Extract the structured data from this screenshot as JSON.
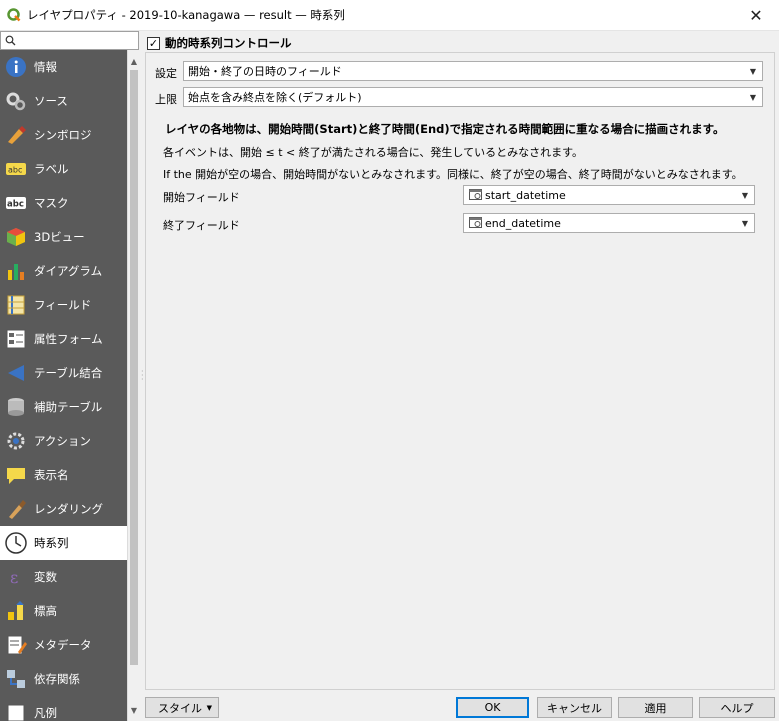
{
  "window": {
    "title": "レイヤプロパティ - 2019-10-kanagawa — result — 時系列",
    "close_glyph": "✕"
  },
  "search": {
    "placeholder": ""
  },
  "sidebar": {
    "items": [
      {
        "label": "情報",
        "icon": "info-icon"
      },
      {
        "label": "ソース",
        "icon": "source-icon"
      },
      {
        "label": "シンボロジ",
        "icon": "symbology-icon"
      },
      {
        "label": "ラベル",
        "icon": "labels-icon"
      },
      {
        "label": "マスク",
        "icon": "mask-icon"
      },
      {
        "label": "3Dビュー",
        "icon": "3d-view-icon"
      },
      {
        "label": "ダイアグラム",
        "icon": "diagram-icon"
      },
      {
        "label": "フィールド",
        "icon": "fields-icon"
      },
      {
        "label": "属性フォーム",
        "icon": "attribute-form-icon"
      },
      {
        "label": "テーブル結合",
        "icon": "joins-icon"
      },
      {
        "label": "補助テーブル",
        "icon": "auxiliary-storage-icon"
      },
      {
        "label": "アクション",
        "icon": "actions-icon"
      },
      {
        "label": "表示名",
        "icon": "display-icon"
      },
      {
        "label": "レンダリング",
        "icon": "rendering-icon"
      },
      {
        "label": "時系列",
        "icon": "clock-icon",
        "active": true
      },
      {
        "label": "変数",
        "icon": "variables-icon"
      },
      {
        "label": "標高",
        "icon": "elevation-icon"
      },
      {
        "label": "メタデータ",
        "icon": "metadata-icon"
      },
      {
        "label": "依存関係",
        "icon": "dependencies-icon"
      },
      {
        "label": "凡例",
        "icon": "legend-icon"
      }
    ]
  },
  "temporal": {
    "enable_label": "動的時系列コントロール",
    "enabled": true,
    "config_label": "設定",
    "config_value": "開始・終了の日時のフィールド",
    "limits_label": "上限",
    "limits_value": "始点を含み終点を除く(デフォルト)",
    "description_bold": "レイヤの各地物は、開始時間(Start)と終了時間(End)で指定される時間範囲に重なる場合に描画されます。",
    "description_1": "各イベントは、開始 ≤ t < 終了が満たされる場合に、発生しているとみなされます。",
    "description_2": "If the 開始が空の場合、開始時間がないとみなされます。同様に、終了が空の場合、終了時間がないとみなされます。",
    "start_field_label": "開始フィールド",
    "start_field_value": "start_datetime",
    "end_field_label": "終了フィールド",
    "end_field_value": "end_datetime"
  },
  "buttons": {
    "style": "スタイル",
    "ok": "OK",
    "cancel": "キャンセル",
    "apply": "適用",
    "help": "ヘルプ"
  }
}
